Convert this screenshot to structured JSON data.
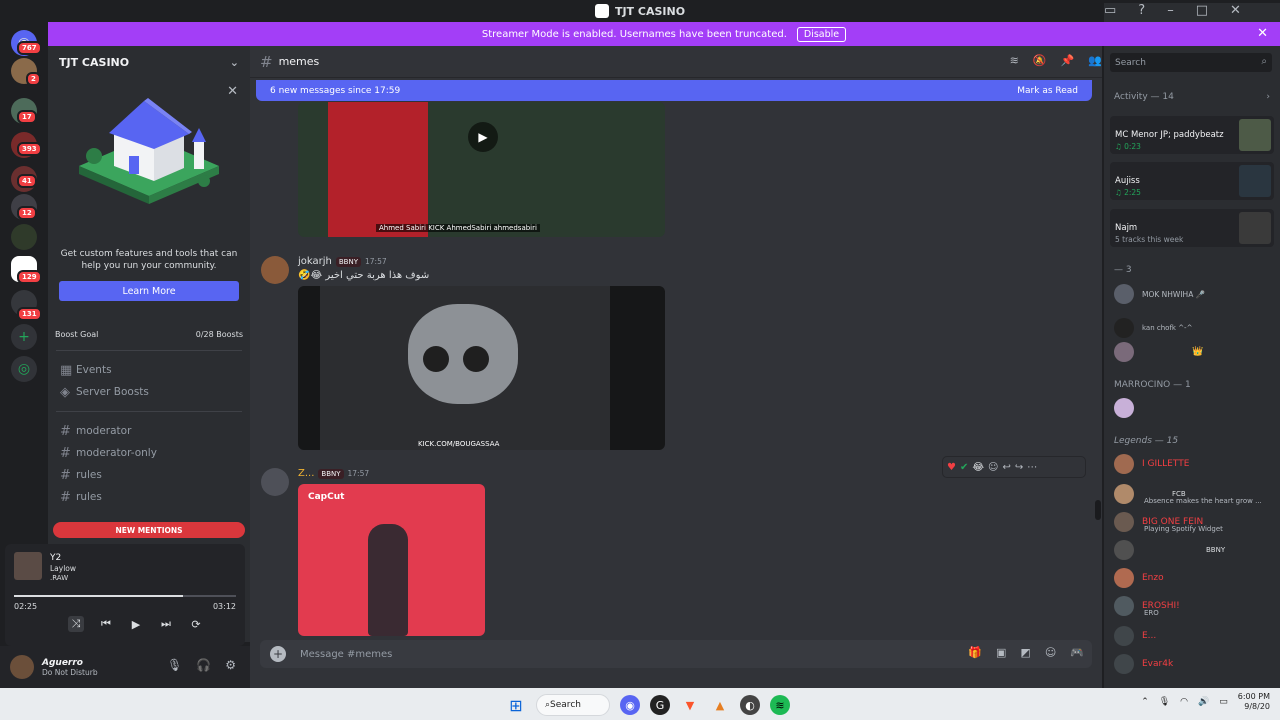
{
  "window": {
    "title": "TJT CASINO"
  },
  "guilds": [
    {
      "badge": "767"
    },
    {
      "badge": "2"
    },
    {
      "badge": "17"
    },
    {
      "badge": "393"
    },
    {
      "badge": "41"
    },
    {
      "badge": "12"
    },
    {
      "badge": ""
    },
    {
      "badge": "129"
    },
    {
      "badge": "131"
    }
  ],
  "banner": {
    "text": "Streamer Mode is enabled. Usernames have been truncated.",
    "disable": "Disable"
  },
  "server": {
    "name": "TJT CASINO",
    "promo_text": "Get custom features and tools that can help you run your community.",
    "learn_more": "Learn More",
    "boost_goal": "Boost Goal",
    "boost_count": "0/28 Boosts",
    "events": "Events",
    "server_boosts": "Server Boosts",
    "channels": [
      "moderator",
      "moderator-only",
      "rules",
      "rules"
    ],
    "new_mentions": "NEW MENTIONS"
  },
  "player": {
    "track": "Y2",
    "artist": "Laylow",
    "album": ".RAW",
    "elapsed": "02:25",
    "duration": "03:12",
    "progress": 0.76
  },
  "user": {
    "name": "Aguerro",
    "status": "Do Not Disturb"
  },
  "chat": {
    "channel": "memes",
    "new_messages": "6 new messages since 17:59",
    "mark_as_read": "Mark as Read",
    "video1_caption": "Ahmed Sabiri   KICK AhmedSabiri   ahmedsabiri",
    "msg1": {
      "author": "jokarjh",
      "badge": "BBNY",
      "time": "17:57",
      "text": "🤣😂 شوف هذا هربة حتي اخير"
    },
    "video2_caption": "KICK.COM/BOUGASSAA",
    "msg2": {
      "author": "Z...",
      "badge": "BBNY",
      "time": "17:57"
    },
    "capcut": "CapCut",
    "composer_placeholder": "Message #memes"
  },
  "right": {
    "search": "Search",
    "activity": "Activity — 14",
    "cards": [
      {
        "name": "MC Menor JP; paddybeatz",
        "sub": "♫ 0:23"
      },
      {
        "name": "Aujiss",
        "sub": "♫ 2:25"
      },
      {
        "name": "Najm",
        "sub": "5 tracks this week"
      }
    ],
    "sect1": "— 3",
    "members1": [
      {
        "name": "MOK NHWIHA 🎤",
        "color": "#b5bac1"
      },
      {
        "name": "kan chofk ^-^",
        "color": "#b5bac1"
      },
      {
        "name": "👑",
        "color": "#f0b232"
      }
    ],
    "sect2": "MARROCINO — 1",
    "sect3": "Legends — 15",
    "members3": [
      {
        "name": "I GILLETTE",
        "color": "#f23f43",
        "sub": ""
      },
      {
        "name": "FCB",
        "color": "#f23f43",
        "sub": "Absence makes the heart grow ..."
      },
      {
        "name": "BIG ONE  FEIN",
        "color": "#f23f43",
        "sub": "Playing Spotify Widget"
      },
      {
        "name": "BBNY",
        "color": "#f23f43",
        "sub": ""
      },
      {
        "name": "Enzo",
        "color": "#f23f43",
        "sub": ""
      },
      {
        "name": "EROSHI!",
        "color": "#f23f43",
        "sub": "ERO"
      },
      {
        "name": "E...",
        "color": "#f23f43",
        "sub": ""
      },
      {
        "name": "Evar4k",
        "color": "#f23f43",
        "sub": ""
      }
    ]
  },
  "taskbar": {
    "search": "Search",
    "time": "6:00 PM",
    "date": "9/8/20"
  }
}
